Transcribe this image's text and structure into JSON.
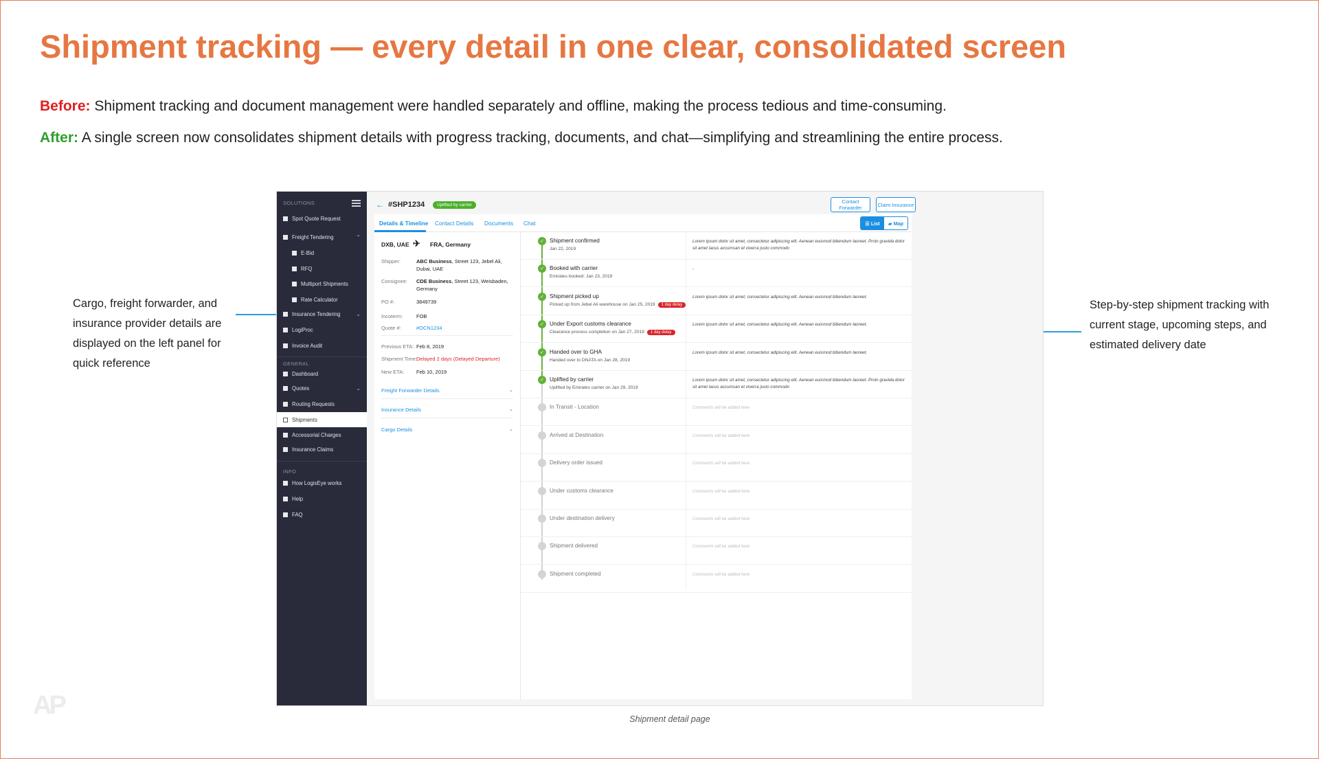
{
  "slide": {
    "title": "Shipment tracking — every detail in one clear, consolidated screen",
    "before_label": "Before:",
    "before_text": "Shipment tracking and document management were handled separately and offline, making the process tedious and time-consuming.",
    "after_label": "After:",
    "after_text": "A single screen now consolidates shipment details with progress tracking, documents, and chat—simplifying and streamlining the entire process.",
    "annotation_left": "Cargo, freight forwarder, and insurance provider details are displayed on the left panel for quick reference",
    "annotation_right": "Step-by-step shipment tracking with current stage, upcoming steps, and estimated delivery date",
    "caption": "Shipment detail page",
    "logo": "AP",
    "colors": {
      "title": "#e67742",
      "before": "#e01e1e",
      "after": "#2e9e2e",
      "accent": "#2b9cdb"
    }
  },
  "sidebar": {
    "sections": {
      "solutions": "SOLUTIONS",
      "general": "GENERAL",
      "info": "INFO"
    },
    "items": [
      {
        "label": "Spot Quote Request"
      },
      {
        "label": "Freight Tendering"
      },
      {
        "label": "E-Bid"
      },
      {
        "label": "RFQ"
      },
      {
        "label": "Multiport Shipments"
      },
      {
        "label": "Rate Calculator"
      },
      {
        "label": "Insurance Tendering"
      },
      {
        "label": "LogiProc"
      },
      {
        "label": "Invoice Audit"
      },
      {
        "label": "Dashboard"
      },
      {
        "label": "Quotes"
      },
      {
        "label": "Routing Requests"
      },
      {
        "label": "Shipments"
      },
      {
        "label": "Accessorial Charges"
      },
      {
        "label": "Insurance Claims"
      },
      {
        "label": "How LogisEye works"
      },
      {
        "label": "Help"
      },
      {
        "label": "FAQ"
      }
    ]
  },
  "header": {
    "shipment_id": "#SHP1234",
    "status": "Uplifted by carrier",
    "contact_forwarder": "Contact Forwarder",
    "claim_insurance": "Claim Insurance"
  },
  "tabs": [
    "Details & Timeline",
    "Contact Details",
    "Documents",
    "Chat"
  ],
  "view_toggle": {
    "list": "List",
    "map": "Map",
    "selected": "List"
  },
  "details": {
    "origin": "DXB, UAE",
    "destination": "FRA, Germany",
    "shipper_label": "Shipper:",
    "shipper_name": "ABC Business",
    "shipper_address": ", Street 123, Jebel Ali, Dubai, UAE",
    "consignee_label": "Consignee:",
    "consignee_name": "CDE Business",
    "consignee_address": ", Street 123, Weisbaden, Germany",
    "po_label": "PO #:",
    "po": "3849739",
    "incoterm_label": "Incoterm:",
    "incoterm": "FOB",
    "quote_label": "Quote #:",
    "quote": "#OCN1234",
    "prev_eta_label": "Previous ETA:",
    "prev_eta": "Feb 8, 2019",
    "shipment_time_label": "Shipment Time:",
    "shipment_time": "Delayed 2 days (Delayed Departure)",
    "new_eta_label": "New ETA:",
    "new_eta": "Feb 10, 2019",
    "accordions": [
      "Freight Forwarder Details",
      "Insurance Details",
      "Cargo Details"
    ]
  },
  "timeline": [
    {
      "title": "Shipment confirmed",
      "sub": "Jan 22, 2019",
      "delay": "",
      "comment": "Lorem ipsum dolor sit amet, consectetur adipiscing elit. Aenean euismod bibendum laoreet. Proin gravida dolor sit amet lacus accumsan et viverra justo commodo",
      "done": true
    },
    {
      "title": "Booked with carrier",
      "sub": "Emirates booked: Jan 23, 2019",
      "delay": "",
      "comment": "-",
      "done": true
    },
    {
      "title": "Shipment picked up",
      "sub": "Picked up from Jebel Ali warehouse on Jan 25, 2019",
      "delay": "1 day delay",
      "comment": "Lorem ipsum dolor sit amet, consectetur adipiscing elit. Aenean euismod bibendum laoreet.",
      "done": true
    },
    {
      "title": "Under Export customs clearance",
      "sub": "Clearance process completion on Jan 27, 2019",
      "delay": "1 day delay",
      "comment": "Lorem ipsum dolor sit amet, consectetur adipiscing elit. Aenean euismod bibendum laoreet.",
      "done": true
    },
    {
      "title": "Handed over to GHA",
      "sub": "Handed over to DNATA on Jan 28, 2019",
      "delay": "",
      "comment": "Lorem ipsum dolor sit amet, consectetur adipiscing elit. Aenean euismod bibendum laoreet.",
      "done": true
    },
    {
      "title": "Uplifted by carrier",
      "sub": "Uplifted by Emirates carrier on Jan 29, 2019",
      "delay": "",
      "comment": "Lorem ipsum dolor sit amet, consectetur adipiscing elit. Aenean euismod bibendum laoreet. Proin gravida dolor sit amet lacus accumsan et viverra justo commodo",
      "done": true
    },
    {
      "title": "In Transit - Location",
      "sub": "",
      "delay": "",
      "comment": "Comments will be added here",
      "done": false
    },
    {
      "title": "Arrived at Destination",
      "sub": "",
      "delay": "",
      "comment": "Comments will be added here",
      "done": false
    },
    {
      "title": "Delivery order issued",
      "sub": "",
      "delay": "",
      "comment": "Comments will be added here",
      "done": false
    },
    {
      "title": "Under customs clearance",
      "sub": "",
      "delay": "",
      "comment": "Comments will be added here",
      "done": false
    },
    {
      "title": "Under destination delivery",
      "sub": "",
      "delay": "",
      "comment": "Comments will be added here",
      "done": false
    },
    {
      "title": "Shipment delivered",
      "sub": "",
      "delay": "",
      "comment": "Comments will be added here",
      "done": false
    },
    {
      "title": "Shipment completed",
      "sub": "",
      "delay": "",
      "comment": "Comments will be added here",
      "done": false
    }
  ]
}
